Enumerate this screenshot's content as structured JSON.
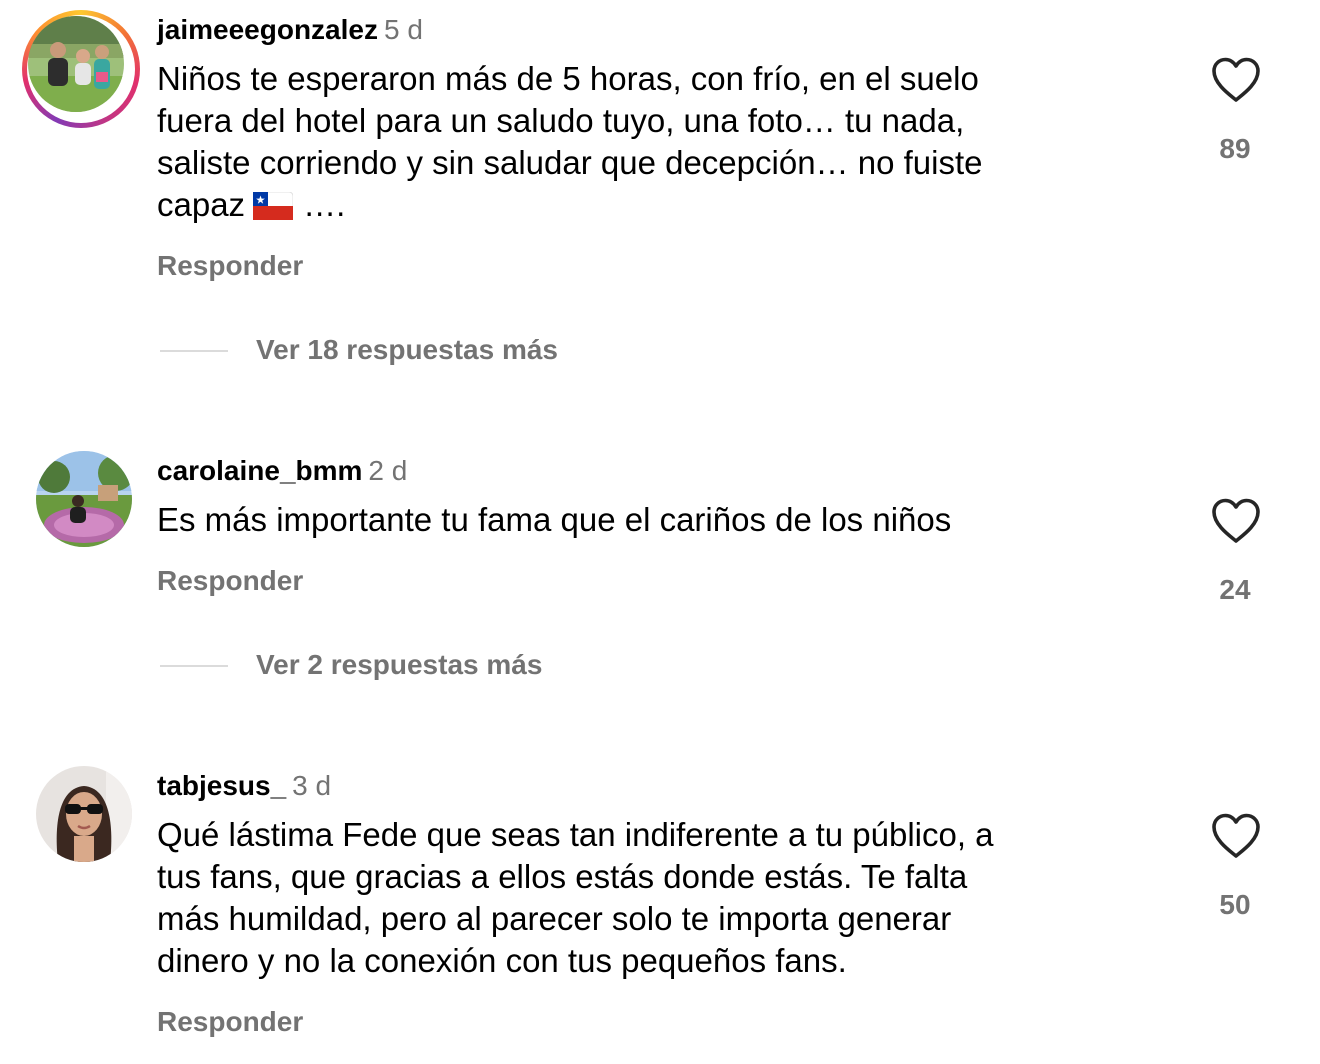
{
  "comments": [
    {
      "username": "jaimeeegonzalez",
      "time": "5 d",
      "lines": [
        "Niños te esperaron más de 5 horas, con frío, en el suelo",
        "fuera del hotel para un saludo tuyo, una foto… tu nada,",
        "saliste corriendo y sin saludar que decepción… no fuiste",
        "capaz"
      ],
      "line_suffix": "….",
      "emoji_name": "chile-flag-emoji",
      "likes": "89",
      "reply_label": "Responder",
      "more_replies": "Ver 18 respuestas más",
      "has_story_ring": true
    },
    {
      "username": "carolaine_bmm",
      "time": "2 d",
      "lines": [
        "Es más importante tu fama que el cariños de los niños"
      ],
      "likes": "24",
      "reply_label": "Responder",
      "more_replies": "Ver 2 respuestas más",
      "has_story_ring": false
    },
    {
      "username": "tabjesus_",
      "time": "3 d",
      "lines": [
        "Qué lástima Fede que seas tan indiferente a tu público, a",
        "tus fans, que gracias a ellos estás donde estás. Te falta",
        "más humildad, pero al parecer solo te importa generar",
        "dinero y no la conexión con tus pequeños fans."
      ],
      "likes": "50",
      "reply_label": "Responder",
      "has_story_ring": false
    }
  ],
  "colors": {
    "text": "#000000",
    "secondary": "#737373",
    "heart_outline": "#262626",
    "divider": "#dbdbdb"
  },
  "icons": {
    "like": "heart-outline-icon"
  }
}
